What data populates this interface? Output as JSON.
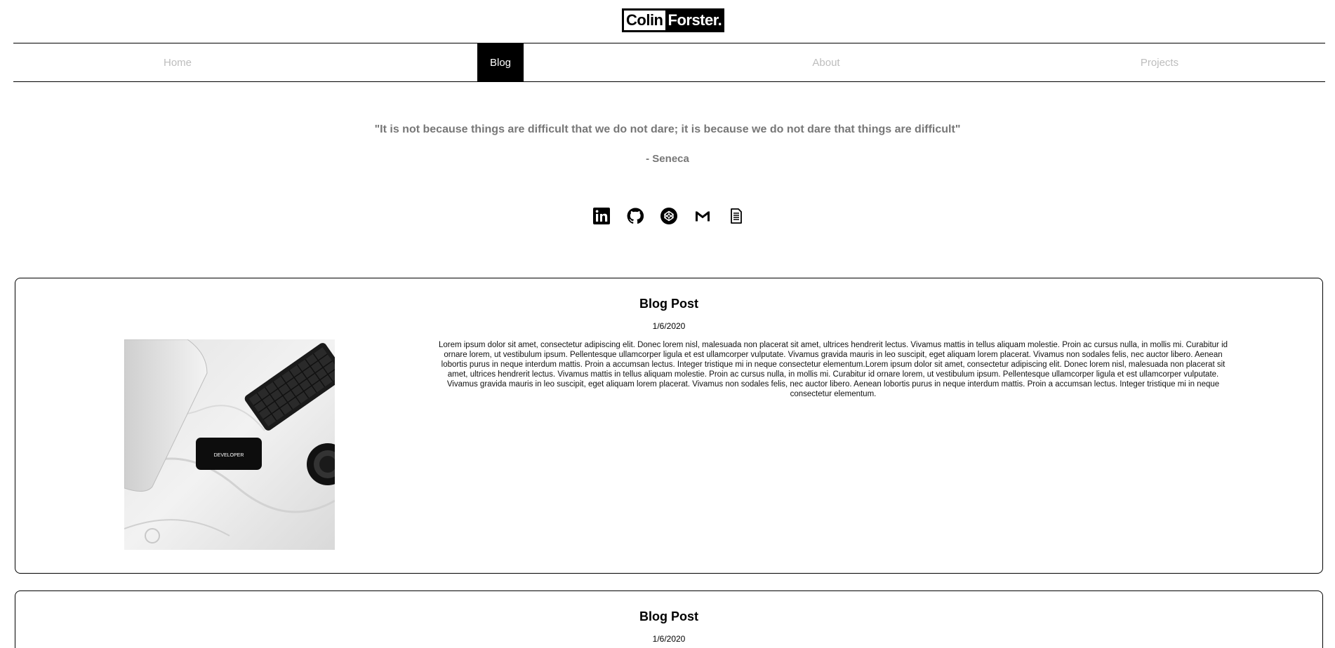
{
  "logo": {
    "first": "Colin",
    "last": "Forster."
  },
  "nav": {
    "items": [
      {
        "label": "Home",
        "active": false
      },
      {
        "label": "Blog",
        "active": true
      },
      {
        "label": "About",
        "active": false
      },
      {
        "label": "Projects",
        "active": false
      }
    ]
  },
  "quote": {
    "text": "\"It is not because things are difficult that we do not dare; it is because we do not dare that things are difficult\"",
    "author": "- Seneca"
  },
  "social": {
    "icons": [
      "linkedin-icon",
      "github-icon",
      "codepen-icon",
      "gmail-icon",
      "document-icon"
    ]
  },
  "posts": [
    {
      "title": "Blog Post",
      "date": "1/6/2020",
      "image_label": "DEVELOPER",
      "body": "Lorem ipsum dolor sit amet, consectetur adipiscing elit. Donec lorem nisl, malesuada non placerat sit amet, ultrices hendrerit lectus. Vivamus mattis in tellus aliquam molestie. Proin ac cursus nulla, in mollis mi. Curabitur id ornare lorem, ut vestibulum ipsum. Pellentesque ullamcorper ligula et est ullamcorper vulputate. Vivamus gravida mauris in leo suscipit, eget aliquam lorem placerat. Vivamus non sodales felis, nec auctor libero. Aenean lobortis purus in neque interdum mattis. Proin a accumsan lectus. Integer tristique mi in neque consectetur elementum.Lorem ipsum dolor sit amet, consectetur adipiscing elit. Donec lorem nisl, malesuada non placerat sit amet, ultrices hendrerit lectus. Vivamus mattis in tellus aliquam molestie. Proin ac cursus nulla, in mollis mi. Curabitur id ornare lorem, ut vestibulum ipsum. Pellentesque ullamcorper ligula et est ullamcorper vulputate. Vivamus gravida mauris in leo suscipit, eget aliquam lorem placerat. Vivamus non sodales felis, nec auctor libero. Aenean lobortis purus in neque interdum mattis. Proin a accumsan lectus. Integer tristique mi in neque consectetur elementum."
    },
    {
      "title": "Blog Post",
      "date": "1/6/2020"
    }
  ],
  "colors": {
    "accent": "#000000",
    "nav_inactive": "#bdbdbd",
    "quote": "#777777"
  }
}
